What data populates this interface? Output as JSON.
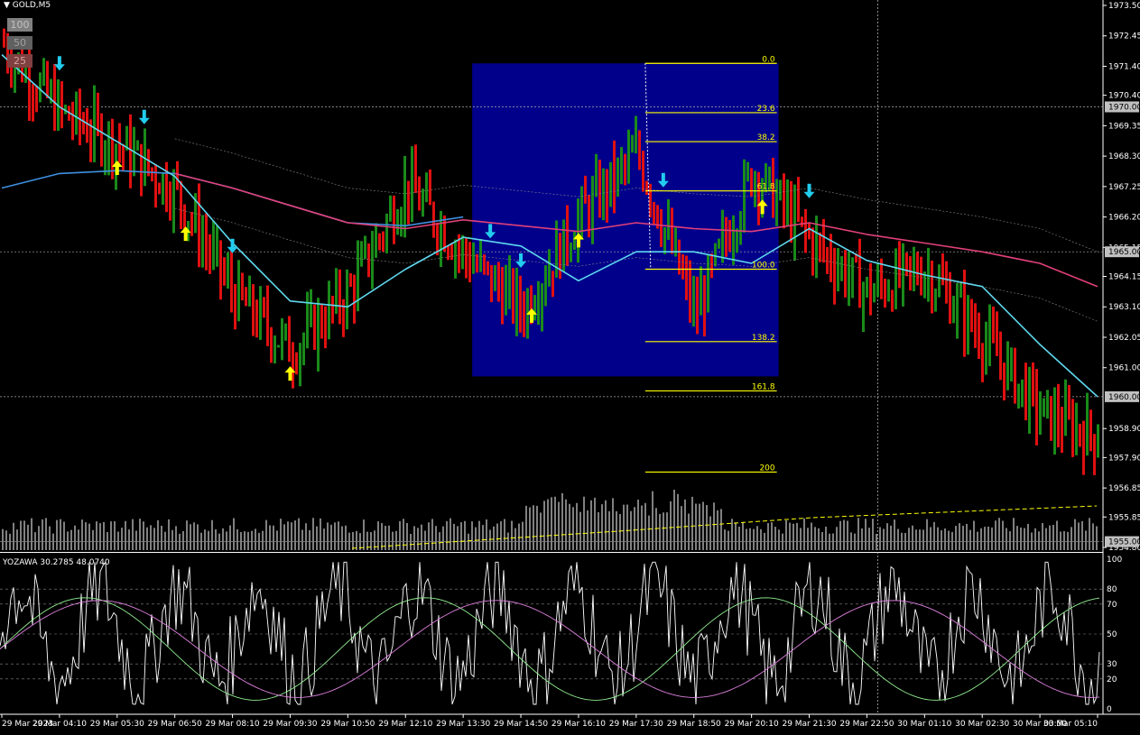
{
  "header": {
    "symbol": "GOLD,M5"
  },
  "buttons": [
    {
      "label": "100",
      "bg": "#808080",
      "fg": "#c0c0c0"
    },
    {
      "label": "50",
      "bg": "#606060",
      "fg": "#a0a0a0"
    },
    {
      "label": "25",
      "bg": "#804040",
      "fg": "#d0a0a0"
    }
  ],
  "colors": {
    "bull": "#1a8a1a",
    "bear": "#e01010",
    "ma_fast": "#5fd7ee",
    "ma_slow": "#e0407a",
    "ma_blue": "#3f8fe0",
    "fib": "#ffff00",
    "box": "#00008b",
    "arrow_up": "#ffff00",
    "arrow_down": "#22ccee",
    "volume": "#ffffff",
    "osc_white": "#ffffff",
    "osc_green": "#90ee90",
    "osc_magenta": "#e080e0"
  },
  "price_scale": {
    "labels": [
      "1973.50",
      "1972.45",
      "1971.40",
      "1970.40",
      "1969.35",
      "1968.30",
      "1967.25",
      "1966.20",
      "1965.15",
      "1964.15",
      "1963.10",
      "1962.05",
      "1961.00",
      "1958.90",
      "1957.90",
      "1956.85",
      "1955.85",
      "1954.80"
    ],
    "highlights": [
      "1970.00",
      "1965.00",
      "1960.00",
      "1955.00"
    ]
  },
  "time_labels": [
    "29 Mar 2023",
    "29 Mar 04:10",
    "29 Mar 05:30",
    "29 Mar 06:50",
    "29 Mar 08:10",
    "29 Mar 09:30",
    "29 Mar 10:50",
    "29 Mar 12:10",
    "29 Mar 13:30",
    "29 Mar 14:50",
    "29 Mar 16:10",
    "29 Mar 17:30",
    "29 Mar 18:50",
    "29 Mar 20:10",
    "29 Mar 21:30",
    "29 Mar 22:50",
    "30 Mar 01:10",
    "30 Mar 02:30",
    "30 Mar 03:50",
    "30 Mar 05:10"
  ],
  "fibonacci": {
    "levels": [
      "0.0",
      "23.6",
      "38.2",
      "61.8",
      "100.0",
      "138.2",
      "161.8",
      "200"
    ]
  },
  "oscillator": {
    "title": "YOZAWA 30.2785 48.0740",
    "levels": [
      "100",
      "80",
      "70",
      "50",
      "30",
      "20",
      "0"
    ]
  },
  "chart_data": {
    "type": "bar",
    "symbol": "GOLD",
    "timeframe": "M5",
    "ylim": [
      1954.8,
      1973.5
    ],
    "x_range": [
      "29 Mar 2023",
      "30 Mar 05:10"
    ],
    "close_path": [
      [
        "29 Mar 2023",
        1972.2
      ],
      [
        "29 Mar 04:10",
        1969.8
      ],
      [
        "29 Mar 05:30",
        1968.7
      ],
      [
        "29 Mar 06:50",
        1967.1
      ],
      [
        "29 Mar 08:10",
        1963.5
      ],
      [
        "29 Mar 09:30",
        1961.6
      ],
      [
        "29 Mar 10:50",
        1963.6
      ],
      [
        "29 Mar 12:10",
        1967.3
      ],
      [
        "29 Mar 13:30",
        1964.9
      ],
      [
        "29 Mar 14:50",
        1963.0
      ],
      [
        "29 Mar 16:10",
        1966.2
      ],
      [
        "29 Mar 17:30",
        1968.4
      ],
      [
        "29 Mar 18:50",
        1962.8
      ],
      [
        "29 Mar 20:10",
        1967.8
      ],
      [
        "29 Mar 21:30",
        1965.4
      ],
      [
        "29 Mar 22:50",
        1963.6
      ],
      [
        "30 Mar 01:10",
        1964.4
      ],
      [
        "30 Mar 02:30",
        1962.0
      ],
      [
        "30 Mar 03:50",
        1959.4
      ],
      [
        "30 Mar 05:10",
        1958.6
      ]
    ],
    "ma_fast": [
      [
        "29 Mar 2023",
        1971.8
      ],
      [
        "29 Mar 04:10",
        1970.0
      ],
      [
        "29 Mar 05:30",
        1968.8
      ],
      [
        "29 Mar 06:50",
        1967.6
      ],
      [
        "29 Mar 08:10",
        1965.3
      ],
      [
        "29 Mar 09:30",
        1963.3
      ],
      [
        "29 Mar 10:50",
        1963.1
      ],
      [
        "29 Mar 12:10",
        1964.4
      ],
      [
        "29 Mar 13:30",
        1965.5
      ],
      [
        "29 Mar 14:50",
        1965.2
      ],
      [
        "29 Mar 16:10",
        1964.0
      ],
      [
        "29 Mar 17:30",
        1965.0
      ],
      [
        "29 Mar 18:50",
        1965.0
      ],
      [
        "29 Mar 20:10",
        1964.6
      ],
      [
        "29 Mar 21:30",
        1965.8
      ],
      [
        "29 Mar 22:50",
        1964.7
      ],
      [
        "30 Mar 01:10",
        1964.2
      ],
      [
        "30 Mar 02:30",
        1963.8
      ],
      [
        "30 Mar 03:50",
        1961.8
      ],
      [
        "30 Mar 05:10",
        1960.0
      ]
    ],
    "ma_slow": [
      [
        "29 Mar 06:50",
        1967.7
      ],
      [
        "29 Mar 08:10",
        1967.2
      ],
      [
        "29 Mar 09:30",
        1966.6
      ],
      [
        "29 Mar 10:50",
        1966.0
      ],
      [
        "29 Mar 12:10",
        1965.8
      ],
      [
        "29 Mar 13:30",
        1966.1
      ],
      [
        "29 Mar 14:50",
        1965.9
      ],
      [
        "29 Mar 16:10",
        1965.7
      ],
      [
        "29 Mar 17:30",
        1966.0
      ],
      [
        "29 Mar 18:50",
        1965.8
      ],
      [
        "29 Mar 20:10",
        1965.7
      ],
      [
        "29 Mar 21:30",
        1966.0
      ],
      [
        "29 Mar 22:50",
        1965.6
      ],
      [
        "30 Mar 01:10",
        1965.3
      ],
      [
        "30 Mar 02:30",
        1965.0
      ],
      [
        "30 Mar 03:50",
        1964.6
      ],
      [
        "30 Mar 05:10",
        1963.8
      ]
    ],
    "ma_blue": [
      [
        "29 Mar 2023",
        1967.2
      ],
      [
        "29 Mar 04:10",
        1967.7
      ],
      [
        "29 Mar 05:30",
        1967.8
      ],
      [
        "29 Mar 06:50",
        1967.7
      ],
      [
        "29 Mar 08:10",
        1967.2
      ],
      [
        "29 Mar 09:30",
        1966.6
      ],
      [
        "29 Mar 10:50",
        1966.0
      ],
      [
        "29 Mar 12:10",
        1965.9
      ],
      [
        "29 Mar 13:30",
        1966.2
      ]
    ],
    "fib_levels": [
      {
        "level": "0.0",
        "price": 1971.5
      },
      {
        "level": "23.6",
        "price": 1969.8
      },
      {
        "level": "38.2",
        "price": 1968.8
      },
      {
        "level": "61.8",
        "price": 1967.1
      },
      {
        "level": "100.0",
        "price": 1964.4
      },
      {
        "level": "138.2",
        "price": 1961.9
      },
      {
        "level": "161.8",
        "price": 1960.2
      },
      {
        "level": "200",
        "price": 1957.4
      }
    ],
    "arrows_up": [
      "29 Mar 05:30",
      "29 Mar 06:50",
      "29 Mar 09:30",
      "29 Mar 14:50",
      "29 Mar 16:10",
      "29 Mar 20:10"
    ],
    "arrows_down": [
      "29 Mar 04:10",
      "29 Mar 05:30",
      "29 Mar 08:10",
      "29 Mar 13:30",
      "29 Mar 14:50",
      "29 Mar 17:30",
      "29 Mar 21:30"
    ],
    "highlight_box": {
      "from": "29 Mar 13:30",
      "to": "29 Mar 20:10",
      "low": 1960.7,
      "high": 1971.5
    },
    "volume_panel": true,
    "oscillator_panel": {
      "ylim": [
        0,
        100
      ],
      "levels": [
        80,
        70,
        50,
        30,
        20
      ]
    },
    "grid": false
  }
}
